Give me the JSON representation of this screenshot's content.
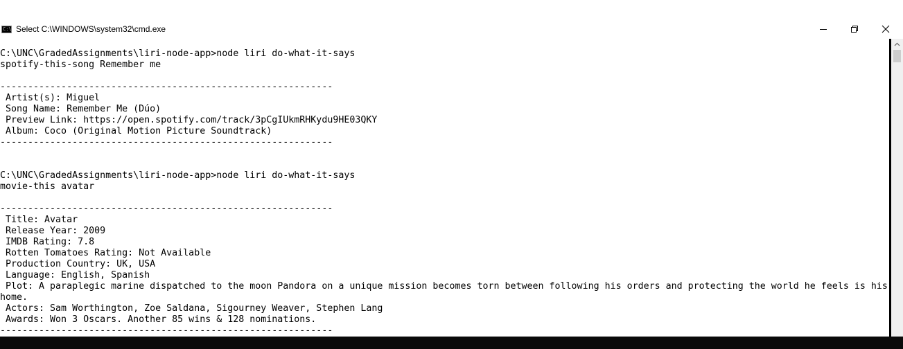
{
  "window": {
    "title": "Select C:\\WINDOWS\\system32\\cmd.exe",
    "icon_name": "cmd-icon",
    "icon_text": "C:\\"
  },
  "console": {
    "lines": [
      "C:\\UNC\\GradedAssignments\\liri-node-app>node liri do-what-it-says",
      "spotify-this-song Remember me",
      "",
      "------------------------------------------------------------",
      " Artist(s): Miguel",
      " Song Name: Remember Me (Dúo)",
      " Preview Link: https://open.spotify.com/track/3pCgIUkmRHKydu9HE03QKY",
      " Album: Coco (Original Motion Picture Soundtrack)",
      "------------------------------------------------------------",
      "",
      "",
      "C:\\UNC\\GradedAssignments\\liri-node-app>node liri do-what-it-says",
      "movie-this avatar",
      "",
      "------------------------------------------------------------",
      " Title: Avatar",
      " Release Year: 2009",
      " IMDB Rating: 7.8",
      " Rotten Tomatoes Rating: Not Available",
      " Production Country: UK, USA",
      " Language: English, Spanish",
      " Plot: A paraplegic marine dispatched to the moon Pandora on a unique mission becomes torn between following his orders and protecting the world he feels is his",
      "home.",
      " Actors: Sam Worthington, Zoe Saldana, Sigourney Weaver, Stephen Lang",
      " Awards: Won 3 Oscars. Another 85 wins & 128 nominations.",
      "------------------------------------------------------------"
    ]
  },
  "colors": {
    "background": "#ffffff",
    "text": "#000000",
    "taskbar": "#0a0a0a"
  }
}
